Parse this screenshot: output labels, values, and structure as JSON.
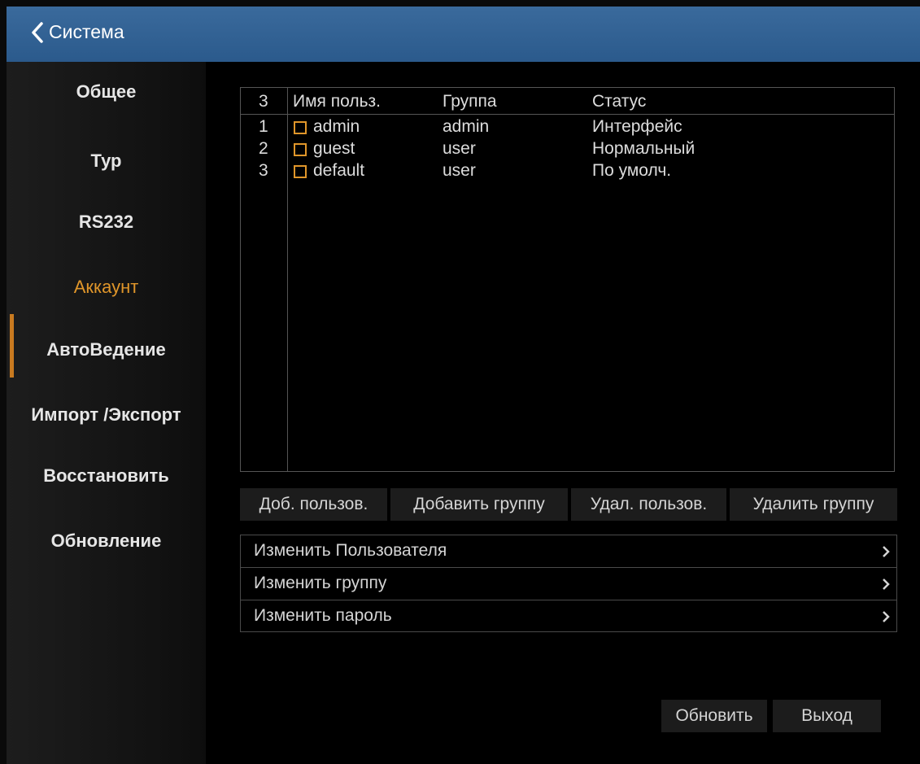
{
  "header": {
    "back_icon": "chevron-left-icon",
    "title": "Система",
    "bg_color": "#2b5a8c"
  },
  "sidebar": {
    "accent_color": "#e0962a",
    "items": [
      {
        "label": "Общее"
      },
      {
        "label": "Тур"
      },
      {
        "label": "RS232"
      },
      {
        "label": "Аккаунт",
        "active": true
      },
      {
        "label": "АвтоВедение"
      },
      {
        "label": "Импорт /Экспорт"
      },
      {
        "label": "Восстановить"
      },
      {
        "label": "Обновление"
      }
    ]
  },
  "users": {
    "count": "3",
    "columns": {
      "name": "Имя польз.",
      "group": "Группа",
      "status": "Статус"
    },
    "rows": [
      {
        "no": "1",
        "name": "admin",
        "group": "admin",
        "status": "Интерфейс"
      },
      {
        "no": "2",
        "name": "guest",
        "group": "user",
        "status": "Нормальный"
      },
      {
        "no": "3",
        "name": "default",
        "group": "user",
        "status": "По умолч."
      }
    ]
  },
  "actions": {
    "add_user": "Доб. пользов.",
    "add_group": "Добавить группу",
    "del_user": "Удал. пользов.",
    "del_group": "Удалить группу"
  },
  "menu": {
    "items": [
      {
        "label": "Изменить Пользователя",
        "icon": "chevron-right-icon"
      },
      {
        "label": "Изменить группу",
        "icon": "chevron-right-icon"
      },
      {
        "label": "Изменить пароль",
        "icon": "chevron-right-icon"
      }
    ]
  },
  "footer": {
    "refresh": "Обновить",
    "exit": "Выход"
  }
}
